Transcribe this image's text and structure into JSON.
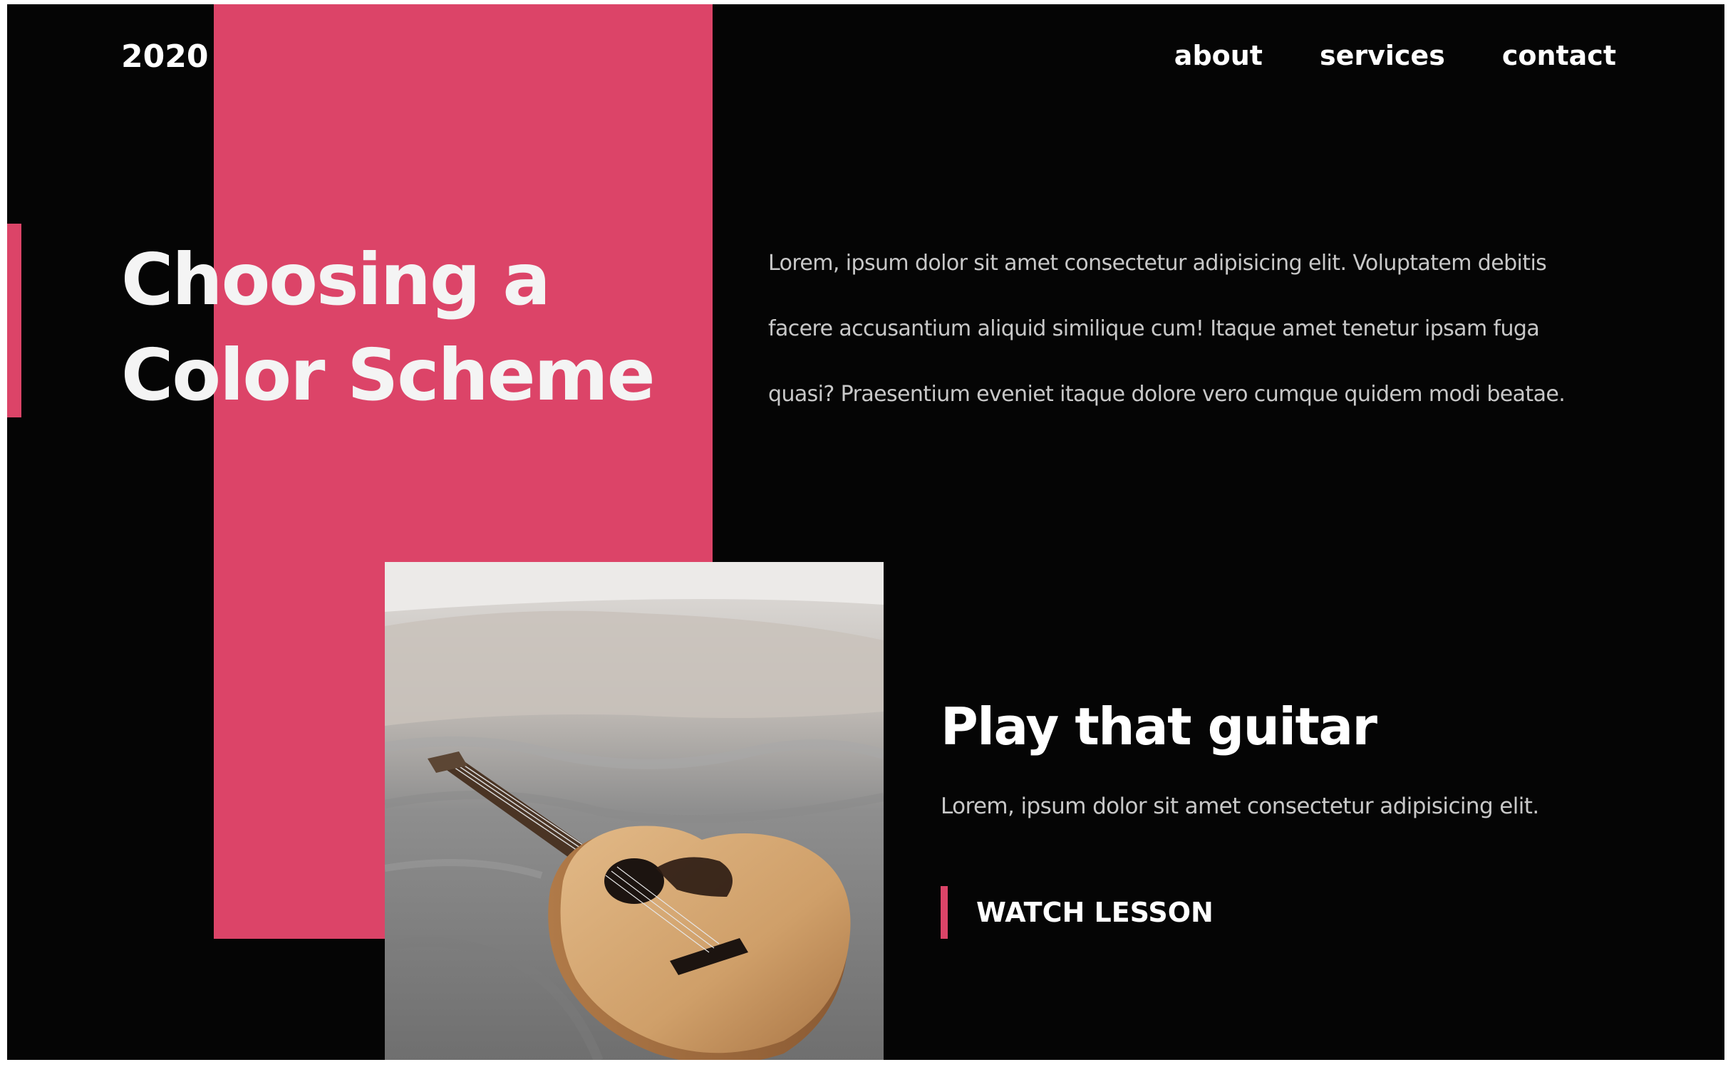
{
  "brand": {
    "logo": "2020"
  },
  "nav": {
    "items": [
      "about",
      "services",
      "contact"
    ]
  },
  "hero": {
    "title_line1": "Choosing a",
    "title_line2": "Color Scheme",
    "intro": "Lorem, ipsum dolor sit amet consectetur adipisicing elit. Voluptatem debitis facere accusantium aliquid similique cum! Itaque amet tenetur ipsam fuga quasi? Praesentium eveniet itaque dolore vero cumque quidem modi beatae."
  },
  "feature": {
    "image": "acoustic-guitar-on-bed-photo",
    "title": "Play that guitar",
    "text": "Lorem, ipsum dolor sit amet consectetur adipisicing elit.",
    "cta_label": "WATCH LESSON"
  },
  "colors": {
    "background": "#050505",
    "accent": "#dc4468",
    "text": "#ffffff",
    "muted_text": "#c8c8c8"
  }
}
